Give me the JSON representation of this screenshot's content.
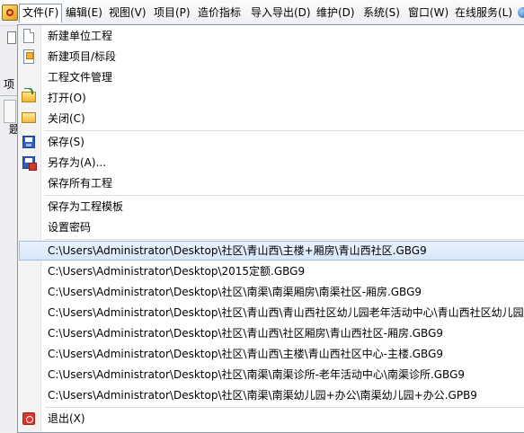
{
  "menubar": {
    "items": [
      {
        "label": "文件(F)",
        "active": true
      },
      {
        "label": "编辑(E)"
      },
      {
        "label": "视图(V)"
      },
      {
        "label": "项目(P)"
      },
      {
        "label": "造价指标"
      },
      {
        "label": "导入导出(D)"
      },
      {
        "label": "维护(D)"
      },
      {
        "label": "系统(S)"
      },
      {
        "label": "窗口(W)"
      },
      {
        "label": "在线服务(L)"
      }
    ]
  },
  "background": {
    "tab_label": "项",
    "cell_label": "题"
  },
  "file_menu": {
    "new_unit_project": "新建单位工程",
    "new_project_section": "新建项目/标段",
    "project_file_manage": "工程文件管理",
    "open": "打开(O)",
    "close": "关闭(C)",
    "save": "保存(S)",
    "save_as": "另存为(A)...",
    "save_all": "保存所有工程",
    "save_as_template": "保存为工程模板",
    "set_password": "设置密码",
    "recent_files": [
      "C:\\Users\\Administrator\\Desktop\\社区\\青山西\\主楼+厢房\\青山西社区.GBG9",
      "C:\\Users\\Administrator\\Desktop\\2015定额.GBG9",
      "C:\\Users\\Administrator\\Desktop\\社区\\南渠\\南渠厢房\\南渠社区-厢房.GBG9",
      "C:\\Users\\Administrator\\Desktop\\社区\\青山西\\青山西社区幼儿园老年活动中心\\青山西社区幼儿园",
      "C:\\Users\\Administrator\\Desktop\\社区\\青山西\\社区厢房\\青山西社区-厢房.GBG9",
      "C:\\Users\\Administrator\\Desktop\\社区\\青山西\\主楼\\青山西社区中心-主楼.GBG9",
      "C:\\Users\\Administrator\\Desktop\\社区\\南渠\\南渠诊所-老年活动中心\\南渠诊所.GBG9",
      "C:\\Users\\Administrator\\Desktop\\社区\\南渠\\南渠幼儿园+办公\\南渠幼儿园+办公.GPB9"
    ],
    "exit": "退出(X)"
  },
  "colors": {
    "highlight_bg": "#d7e7fa",
    "highlight_border": "#9dc0ea",
    "menu_border": "#8f98a6"
  }
}
